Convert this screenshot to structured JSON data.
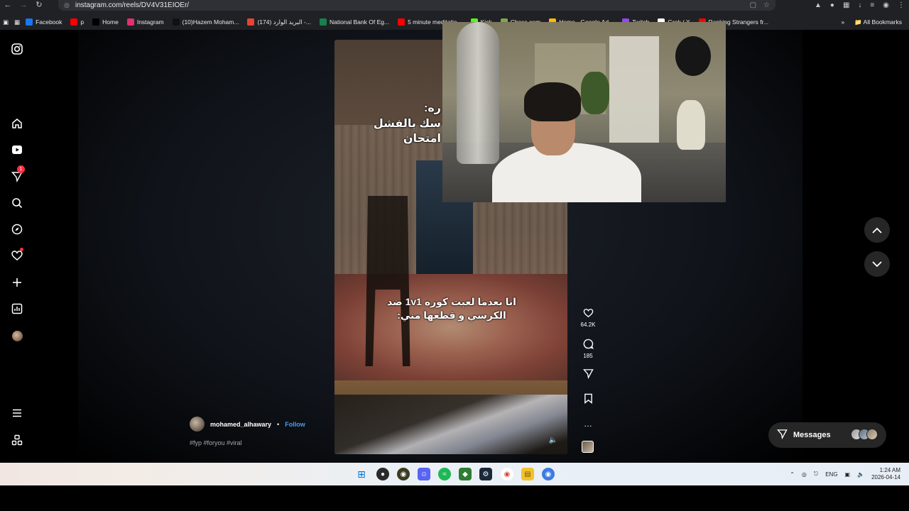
{
  "browser": {
    "url": "instagram.com/reels/DV4V31EIOEr/",
    "all_bookmarks": "All Bookmarks",
    "bookmarks": [
      {
        "label": "Facebook",
        "color": "#1877f2"
      },
      {
        "label": "p",
        "color": "#ff0000"
      },
      {
        "label": "Home",
        "color": "#000000"
      },
      {
        "label": "Instagram",
        "color": "#e1306c"
      },
      {
        "label": "(10)Hazem Moham...",
        "color": "#111111"
      },
      {
        "label": "(174) البريد الوارد -...",
        "color": "#ea4335"
      },
      {
        "label": "National Bank Of Eg...",
        "color": "#1a7f4e"
      },
      {
        "label": "5 minute meditatio...",
        "color": "#ff0000"
      },
      {
        "label": "Kick",
        "color": "#53fc18"
      },
      {
        "label": "Chess.com",
        "color": "#7fa650"
      },
      {
        "label": "Home - Google Ad...",
        "color": "#fbbc04"
      },
      {
        "label": "Twitch",
        "color": "#9146ff"
      },
      {
        "label": "Grok / X",
        "color": "#ffffff"
      },
      {
        "label": "Ranking Strangers fr...",
        "color": "#ff0000"
      }
    ]
  },
  "reel": {
    "caption_top": "ره:\nسك بالفشل\nامتحان",
    "caption_mid": "انا بعدما لعبت كوره 1v1 ضد الكرسي و قطعها مني:",
    "likes": "64.2K",
    "comments": "185",
    "author": "mohamed_alhawary",
    "separator": "•",
    "follow": "Follow",
    "tags": "#fyp #foryou #viral"
  },
  "sidebar": {
    "notification_count": "1"
  },
  "messages": {
    "label": "Messages"
  },
  "taskbar": {
    "lang": "ENG",
    "time": "1:24 AM",
    "date": "2026-04-14"
  }
}
